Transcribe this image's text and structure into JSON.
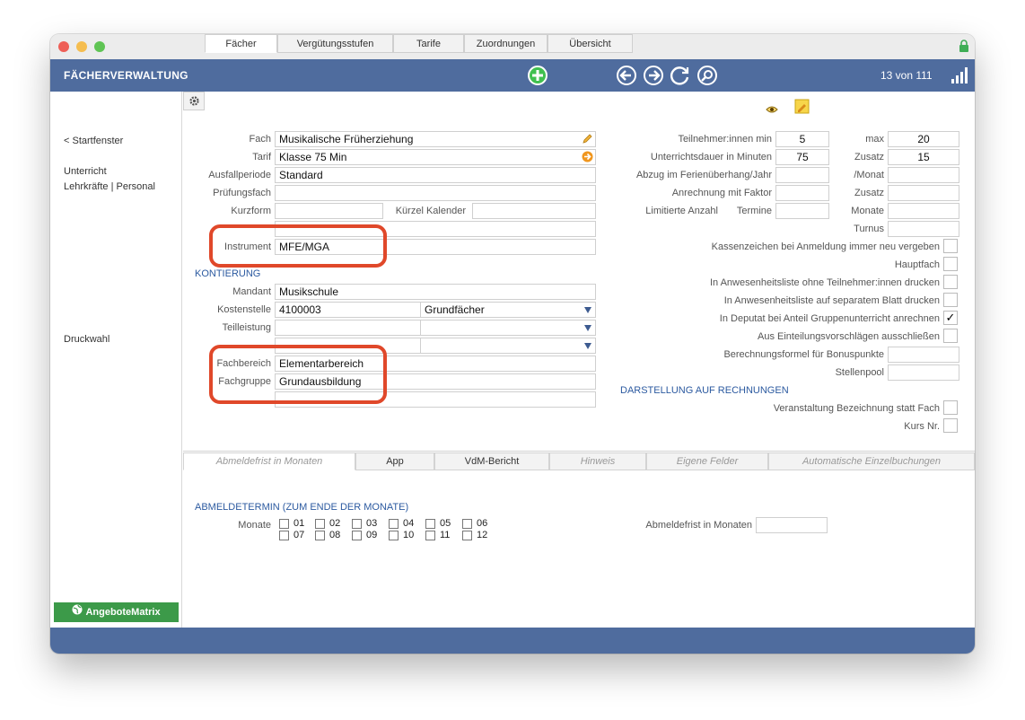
{
  "app": {
    "title": "FÄCHERVERWALTUNG",
    "record_count": "13 von 111"
  },
  "sidebar": {
    "back": "< Startfenster",
    "unterricht": "Unterricht",
    "lehrkraefte": "Lehrkräfte | Personal",
    "druckwahl": "Druckwahl",
    "matrix_button": "AngeboteMatrix"
  },
  "tabs": [
    "Fächer",
    "Vergütungsstufen",
    "Tarife",
    "Zuordnungen",
    "Übersicht"
  ],
  "left_form": {
    "fach_label": "Fach",
    "fach_value": "Musikalische Früherziehung",
    "tarif_label": "Tarif",
    "tarif_value": "Klasse 75 Min",
    "ausfall_label": "Ausfallperiode",
    "ausfall_value": "Standard",
    "pruef_label": "Prüfungsfach",
    "pruef_value": "",
    "kurz_label": "Kurzform",
    "kurz_value": "",
    "kuerzel_label": "Kürzel Kalender",
    "kuerzel_value": "",
    "instrument_label": "Instrument",
    "instrument_value": "MFE/MGA",
    "kontierung": "KONTIERUNG",
    "mandant_label": "Mandant",
    "mandant_value": "Musikschule",
    "kosten_label": "Kostenstelle",
    "kosten_value": "4100003",
    "kosten_select": "Grundfächer",
    "teil_label": "Teilleistung",
    "teil_value": "",
    "teil_select": "",
    "fachbereich_label": "Fachbereich",
    "fachbereich_value": "Elementarbereich",
    "fachgruppe_label": "Fachgruppe",
    "fachgruppe_value": "Grundausbildung"
  },
  "right_form": {
    "tn_min_label": "Teilnehmer:innen min",
    "tn_min_value": "5",
    "max_label": "max",
    "max_value": "20",
    "dauer_label": "Unterrichtsdauer in Minuten",
    "dauer_value": "75",
    "zusatz_label": "Zusatz",
    "zusatz_value": "15",
    "abzug_label": "Abzug im Ferienüberhang/Jahr",
    "abzug_value": "",
    "monat_label": "/Monat",
    "monat_value": "",
    "anrechnung_label": "Anrechnung mit Faktor",
    "anrechnung_value": "",
    "zusatz2_label": "Zusatz",
    "zusatz2_value": "",
    "limitiert_label": "Limitierte Anzahl",
    "termine_label": "Termine",
    "termine_value": "",
    "monate_label": "Monate",
    "monate_value": "",
    "turnus_label": "Turnus",
    "turnus_value": "",
    "kassen_label": "Kassenzeichen bei Anmeldung immer neu vergeben",
    "hauptfach_label": "Hauptfach",
    "anw_ohne_label": "In Anwesenheitsliste ohne Teilnehmer:innen drucken",
    "anw_sep_label": "In Anwesenheitsliste auf separatem Blatt drucken",
    "deputat_label": "In Deputat bei Anteil Gruppenunterricht anrechnen",
    "deputat_check": "✓",
    "einteilung_label": "Aus Einteilungsvorschlägen ausschließen",
    "bonus_label": "Berechnungsformel für Bonuspunkte",
    "bonus_value": "",
    "stellen_label": "Stellenpool",
    "stellen_value": "",
    "darstellung": "DARSTELLUNG AUF RECHNUNGEN",
    "veranstaltung_label": "Veranstaltung Bezeichnung statt Fach",
    "kurs_label": "Kurs Nr."
  },
  "bottom_tabs": [
    "Abmeldefrist in Monaten",
    "App",
    "VdM-Bericht",
    "Hinweis",
    "Eigene Felder",
    "Automatische Einzelbuchungen"
  ],
  "abmelde": {
    "title": "ABMELDETERMIN (ZUM ENDE DER MONATE)",
    "monate_label": "Monate",
    "months": [
      "01",
      "02",
      "03",
      "04",
      "05",
      "06",
      "07",
      "08",
      "09",
      "10",
      "11",
      "12"
    ],
    "frist_label": "Abmeldefrist in Monaten",
    "frist_value": ""
  },
  "colors": {
    "topbar": "#4f6c9e",
    "accent_section": "#2c5aa0",
    "highlight": "#e0482a",
    "matrix_button": "#3c9a49"
  },
  "icons": [
    "gear-icon",
    "eye-icon",
    "note-icon",
    "add-icon",
    "back-arrow-icon",
    "forward-arrow-icon",
    "refresh-icon",
    "search-icon",
    "signal-icon",
    "lock-icon",
    "pencil-icon",
    "link-arrow-icon",
    "globe-icon"
  ]
}
